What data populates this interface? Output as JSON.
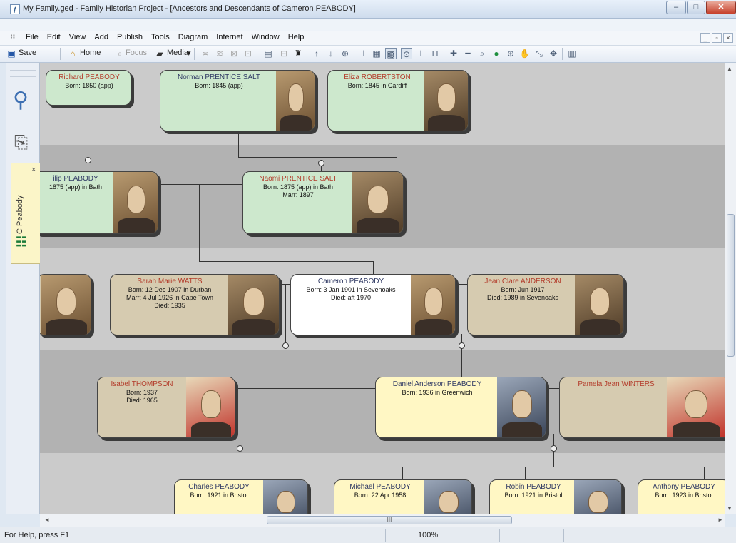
{
  "window": {
    "title": "My Family.ged - Family Historian Project - [Ancestors and Descendants of Cameron PEABODY]",
    "app_icon": "fh-app-icon",
    "minimize": "–",
    "maximize": "□",
    "close": "✕"
  },
  "menu": [
    "File",
    "Edit",
    "View",
    "Add",
    "Publish",
    "Tools",
    "Diagram",
    "Internet",
    "Window",
    "Help"
  ],
  "toolbar": {
    "save": "Save",
    "home": "Home",
    "focus": "Focus",
    "media": "Media"
  },
  "sidebar": {
    "tab_label": "C Peabody",
    "tab_close": "×"
  },
  "people": {
    "richard": {
      "name": "Richard PEABODY",
      "details": "Born: 1850 (app)"
    },
    "norman": {
      "name": "Norman PRENTICE SALT",
      "details": "Born: 1845 (app)"
    },
    "eliza": {
      "name": "Eliza ROBERTSTON",
      "details": "Born: 1845 in Cardiff"
    },
    "philip": {
      "name": "ilip PEABODY",
      "details": "1875 (app) in Bath"
    },
    "naomi": {
      "name": "Naomi PRENTICE SALT",
      "details": "Born: 1875 (app) in Bath\nMarr: 1897"
    },
    "sarah": {
      "name": "Sarah Marie WATTS",
      "details": "Born: 12 Dec 1907 in Durban\nMarr: 4 Jul 1926 in Cape Town\nDied: 1935"
    },
    "cameron": {
      "name": "Cameron PEABODY",
      "details": "Born: 3 Jan 1901 in Sevenoaks\nDied: aft 1970"
    },
    "jean": {
      "name": "Jean Clare ANDERSON",
      "details": "Born: Jun 1917\nDied: 1989 in Sevenoaks"
    },
    "isabel": {
      "name": "Isabel THOMPSON",
      "details": "Born: 1937\nDied: 1965"
    },
    "daniel": {
      "name": "Daniel Anderson PEABODY",
      "details": "Born: 1936 in Greenwich"
    },
    "pamela": {
      "name": "Pamela Jean WINTERS",
      "details": ""
    },
    "charles": {
      "name": "Charles PEABODY",
      "details": "Born: 1921 in Bristol"
    },
    "michael": {
      "name": "Michael PEABODY",
      "details": "Born: 22 Apr 1958"
    },
    "robin": {
      "name": "Robin PEABODY",
      "details": "Born: 1921 in Bristol"
    },
    "anthony": {
      "name": "Anthony PEABODY",
      "details": "Born: 1923 in Bristol"
    }
  },
  "colors": {
    "name_red": "#b33c2b",
    "name_dark": "#303a64",
    "box_green": "#cde8cd",
    "box_tan": "#d6cbb0",
    "box_cream": "#fff7c4"
  },
  "status": {
    "help": "For Help, press F1",
    "zoom": "100%"
  },
  "scroll": {
    "grip": "III"
  }
}
